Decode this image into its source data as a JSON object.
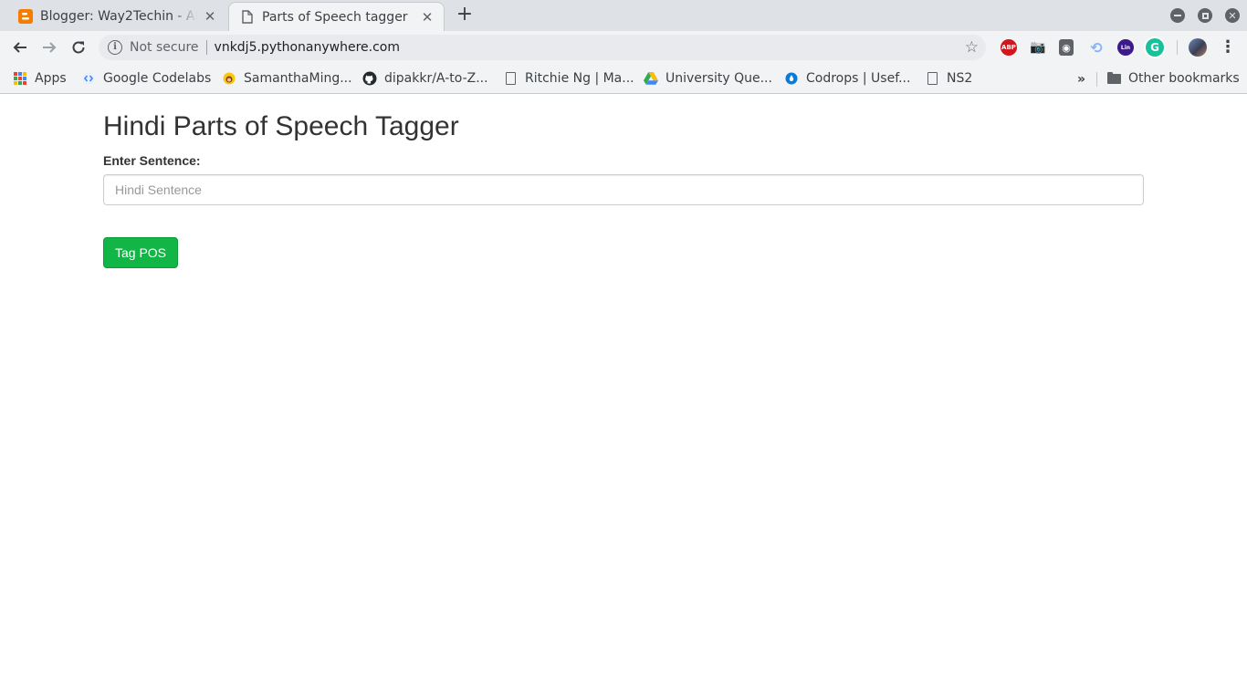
{
  "browser": {
    "tabs": [
      {
        "title": "Blogger: Way2Techin - All",
        "favicon": "blogger-icon",
        "active": false
      },
      {
        "title": "Parts of Speech tagger",
        "favicon": "document-icon",
        "active": true
      }
    ],
    "new_tab_symbol": "+",
    "security_label": "Not secure",
    "url": "vnkdj5.pythonanywhere.com",
    "bookmarks": [
      {
        "label": "Apps",
        "icon": "apps-grid-icon"
      },
      {
        "label": "Google Codelabs",
        "icon": "codelabs-icon"
      },
      {
        "label": "SamanthaMing...",
        "icon": "samantha-icon"
      },
      {
        "label": "dipakkr/A-to-Z...",
        "icon": "github-icon"
      },
      {
        "label": "Ritchie Ng | Ma...",
        "icon": "document-icon"
      },
      {
        "label": "University Que...",
        "icon": "google-drive-icon"
      },
      {
        "label": "Codrops | Usef...",
        "icon": "codrops-icon"
      },
      {
        "label": "NS2",
        "icon": "document-icon"
      }
    ],
    "overflow_symbol": "»",
    "other_bookmarks": "Other bookmarks",
    "extensions": [
      "adblock-plus-icon",
      "camera-icon",
      "bulb-icon",
      "link-icon",
      "linkedin-learning-icon",
      "grammarly-icon"
    ],
    "colors": {
      "tabstrip": "#dee1e6",
      "toolbar": "#f2f3f5"
    }
  },
  "page": {
    "title": "Hindi Parts of Speech Tagger",
    "field_label": "Enter Sentence:",
    "input_placeholder": "Hindi Sentence",
    "input_value": "",
    "submit_label": "Tag POS",
    "colors": {
      "button": "#11b646",
      "text": "#333333"
    }
  }
}
